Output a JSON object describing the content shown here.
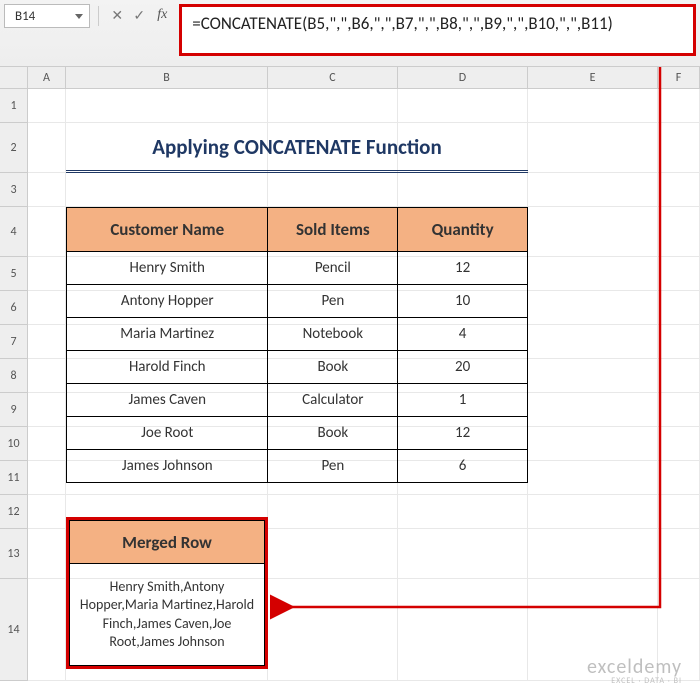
{
  "name_box": "B14",
  "formula_bar": "=CONCATENATE(B5,\",\",B6,\",\",B7,\",\",B8,\",\",B9,\",\",B10,\",\",B11)",
  "fx_label": "fx",
  "columns": [
    "A",
    "B",
    "C",
    "D",
    "E",
    "F"
  ],
  "rows": [
    "1",
    "2",
    "3",
    "4",
    "5",
    "6",
    "7",
    "8",
    "9",
    "10",
    "11",
    "12",
    "13",
    "14"
  ],
  "title": "Applying CONCATENATE Function",
  "table": {
    "headers": [
      "Customer Name",
      "Sold Items",
      "Quantity"
    ],
    "rows": [
      [
        "Henry Smith",
        "Pencil",
        "12"
      ],
      [
        "Antony Hopper",
        "Pen",
        "10"
      ],
      [
        "Maria Martinez",
        "Notebook",
        "4"
      ],
      [
        "Harold Finch",
        "Book",
        "20"
      ],
      [
        "James Caven",
        "Calculator",
        "1"
      ],
      [
        "Joe Root",
        "Book",
        "12"
      ],
      [
        "James Johnson",
        "Pen",
        "6"
      ]
    ]
  },
  "merged": {
    "header": "Merged Row",
    "value": "Henry Smith,Antony Hopper,Maria Martinez,Harold Finch,James Caven,Joe Root,James Johnson"
  },
  "watermark": {
    "big": "exceldemy",
    "small": "EXCEL · DATA · BI"
  }
}
